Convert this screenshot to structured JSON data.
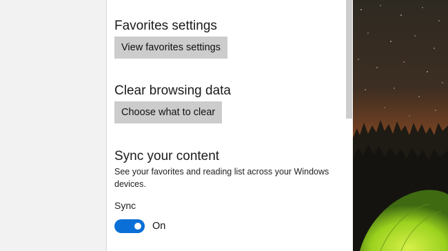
{
  "sections": {
    "favorites": {
      "title": "Favorites settings",
      "button_label": "View favorites settings"
    },
    "clear": {
      "title": "Clear browsing data",
      "button_label": "Choose what to clear"
    },
    "sync": {
      "title": "Sync your content",
      "description": "See your favorites and reading list across your Windows devices.",
      "field_label": "Sync",
      "toggle_state": "On",
      "toggle_on": true
    }
  },
  "colors": {
    "toggle_accent": "#0a6fd6",
    "button_bg": "#cccccc"
  }
}
